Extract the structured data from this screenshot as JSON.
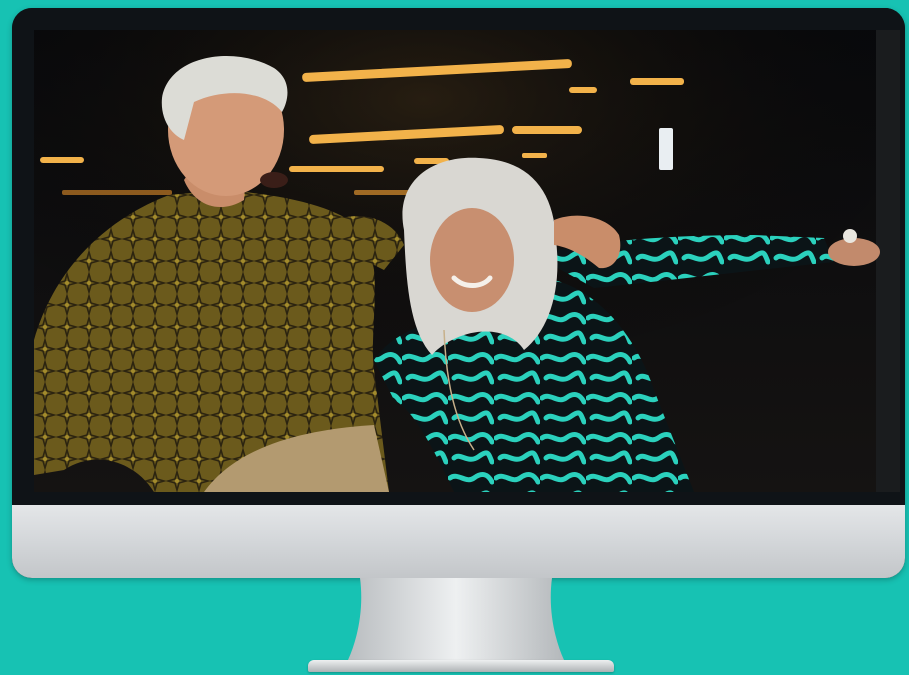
{
  "scene": {
    "background_color": "#17c2b3",
    "device": "desktop-monitor",
    "screen_content": "photo"
  },
  "colors": {
    "bezel": "#0f1317",
    "chin": "#d5d8db",
    "stand": "#c9cdd0"
  }
}
